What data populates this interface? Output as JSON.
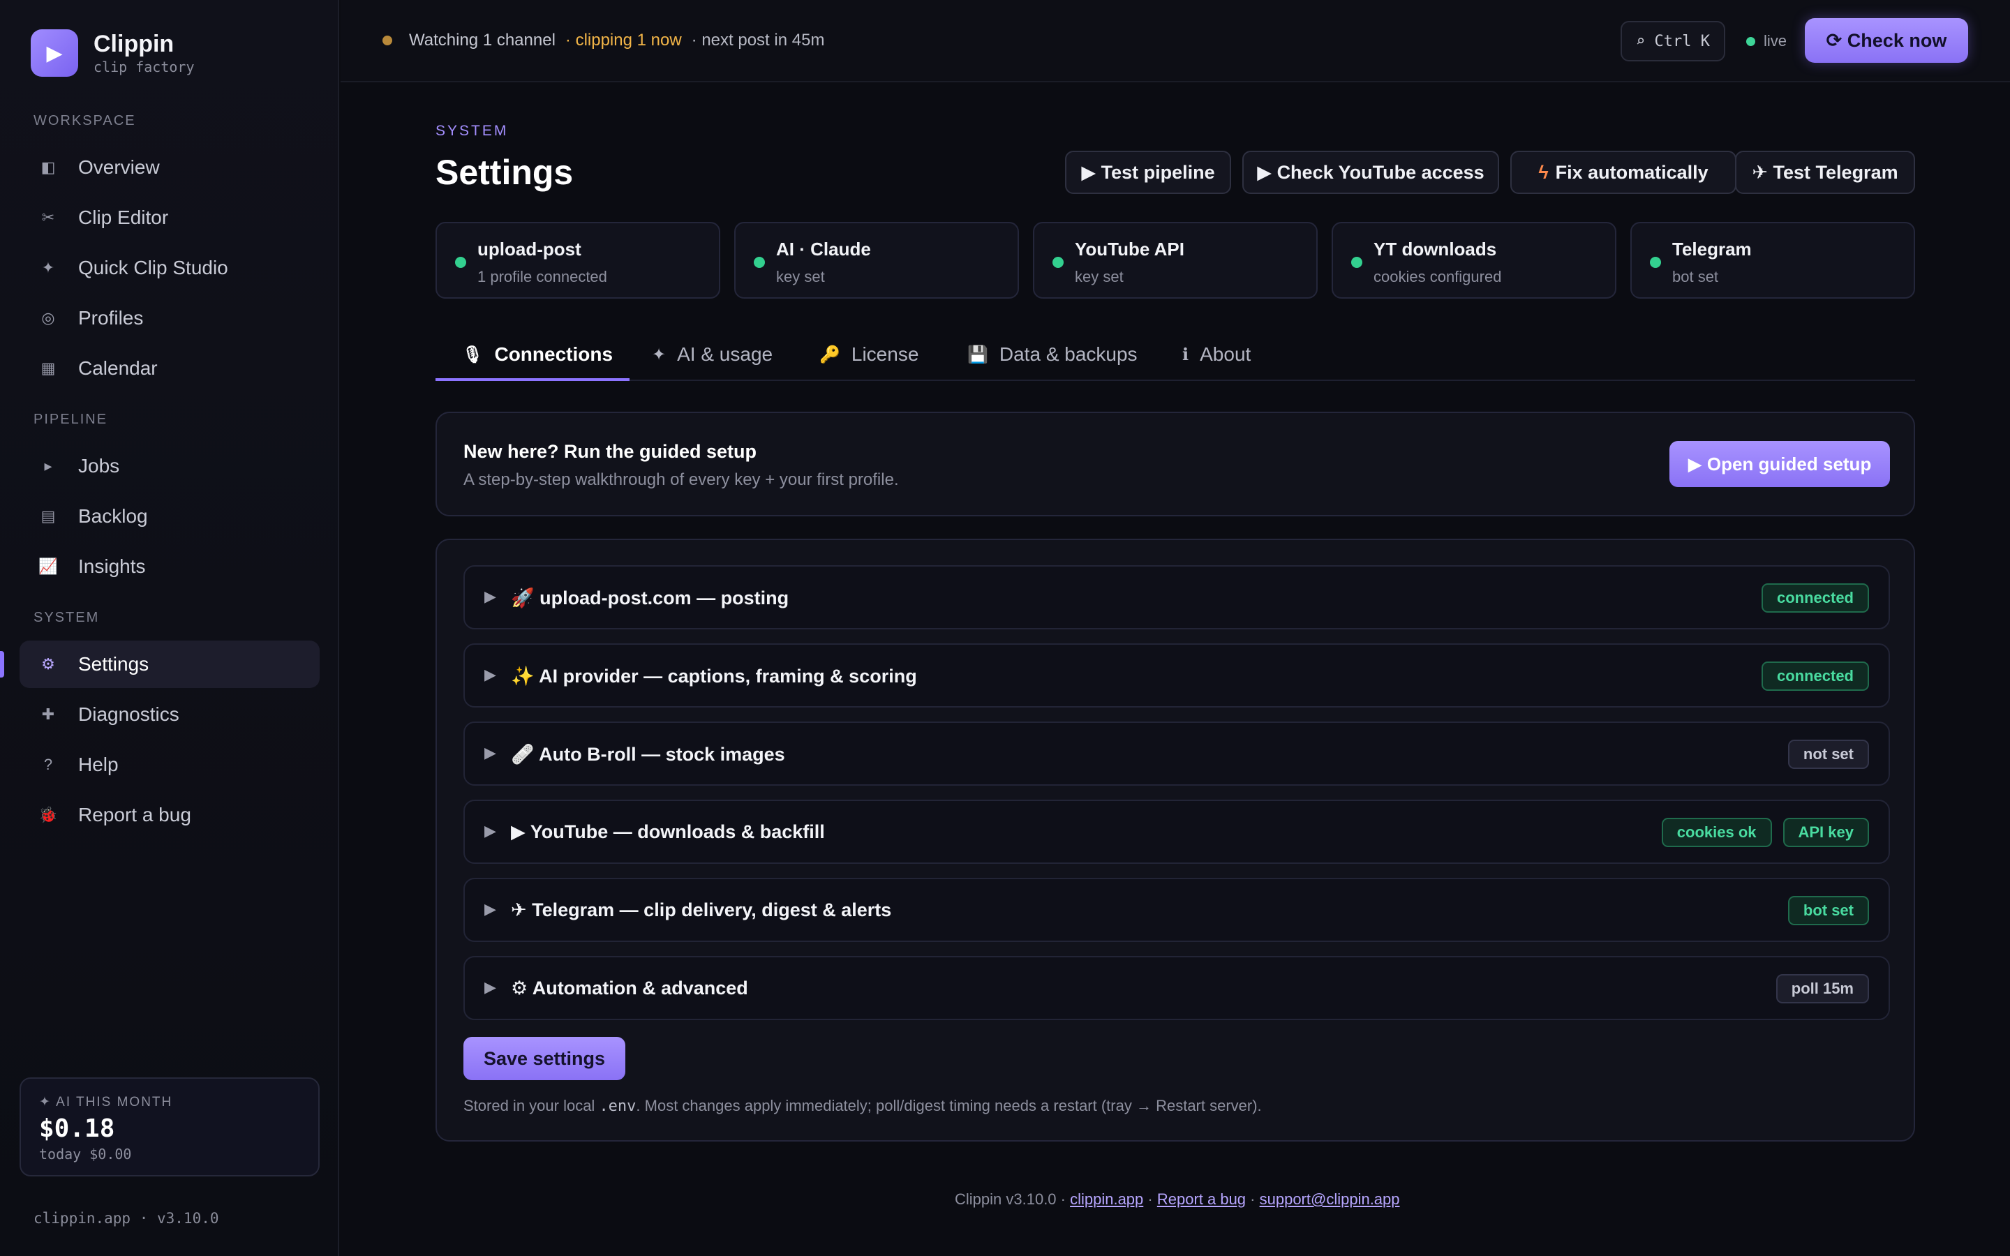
{
  "brand": {
    "name": "Clippin",
    "sub": "clip factory",
    "logo_icon": "play-icon"
  },
  "nav": {
    "sections": [
      "WORKSPACE",
      "PIPELINE",
      "SYSTEM"
    ],
    "workspace": [
      {
        "label": "Overview",
        "icon": "◧"
      },
      {
        "label": "Clip Editor",
        "icon": "✂"
      },
      {
        "label": "Quick Clip Studio",
        "icon": "✦"
      },
      {
        "label": "Profiles",
        "icon": "◎"
      },
      {
        "label": "Calendar",
        "icon": "▦"
      }
    ],
    "pipeline": [
      {
        "label": "Jobs",
        "icon": "▸"
      },
      {
        "label": "Backlog",
        "icon": "▤"
      },
      {
        "label": "Insights",
        "icon": "📈"
      }
    ],
    "system": [
      {
        "label": "Settings",
        "icon": "⚙"
      },
      {
        "label": "Diagnostics",
        "icon": "✚"
      },
      {
        "label": "Help",
        "icon": "?"
      },
      {
        "label": "Report a bug",
        "icon": "🐞"
      }
    ]
  },
  "ai_month": {
    "label": "✦ AI THIS MONTH",
    "amount": "$0.18",
    "today": "today $0.00"
  },
  "sidebar_footer": "clippin.app · v3.10.0",
  "topbar": {
    "watching": "Watching 1 channel",
    "clipping": "· clipping 1 now",
    "next_post": "· next post in 45m",
    "shortcut": "⌕ Ctrl K",
    "live": "live",
    "check_now": "⟳ Check now"
  },
  "page": {
    "eyebrow": "SYSTEM",
    "title": "Settings",
    "actions": [
      "▶ Test pipeline",
      "▶ Check YouTube access",
      "Fix automatically",
      "✈ Test Telegram"
    ],
    "fix_icon": "ϟ"
  },
  "services": [
    {
      "title": "upload-post",
      "sub": "1 profile connected"
    },
    {
      "title": "AI · Claude",
      "sub": "key set"
    },
    {
      "title": "YouTube API",
      "sub": "key set"
    },
    {
      "title": "YT downloads",
      "sub": "cookies configured"
    },
    {
      "title": "Telegram",
      "sub": "bot set"
    }
  ],
  "tabs": [
    {
      "label": "Connections",
      "icon": "🎙"
    },
    {
      "label": "AI & usage",
      "icon": "✦"
    },
    {
      "label": "License",
      "icon": "🔑"
    },
    {
      "label": "Data & backups",
      "icon": "💾"
    },
    {
      "label": "About",
      "icon": "ℹ"
    }
  ],
  "guide": {
    "title": "New here? Run the guided setup",
    "sub": "A step-by-step walkthrough of every key + your first profile.",
    "button": "▶ Open guided setup"
  },
  "sections": [
    {
      "title": "🚀 upload-post.com — posting",
      "badges": [
        "connected"
      ]
    },
    {
      "title": "✨ AI provider — captions, framing & scoring",
      "badges": [
        "connected"
      ]
    },
    {
      "title": "🩹 Auto B-roll — stock images",
      "badges": [
        "not set"
      ]
    },
    {
      "title": "▶ YouTube — downloads & backfill",
      "badges": [
        "cookies ok",
        "API key"
      ]
    },
    {
      "title": "✈ Telegram — clip delivery, digest & alerts",
      "badges": [
        "bot set"
      ]
    },
    {
      "title": "⚙ Automation & advanced",
      "badges": [
        "poll 15m"
      ]
    }
  ],
  "save_label": "Save settings",
  "note": {
    "prefix": "Stored in your local ",
    "file": ".env",
    "suffix": ". Most changes apply immediately; poll/digest timing needs a restart (tray → Restart server)."
  },
  "footer": {
    "version": "Clippin v3.10.0 · ",
    "site": "clippin.app",
    "sep1": " · ",
    "bug": "Report a bug",
    "sep2": " · ",
    "email": "support@clippin.app"
  },
  "colors": {
    "accent": "#8c74ff",
    "ok": "#33d08f",
    "warn": "#f2b548"
  }
}
